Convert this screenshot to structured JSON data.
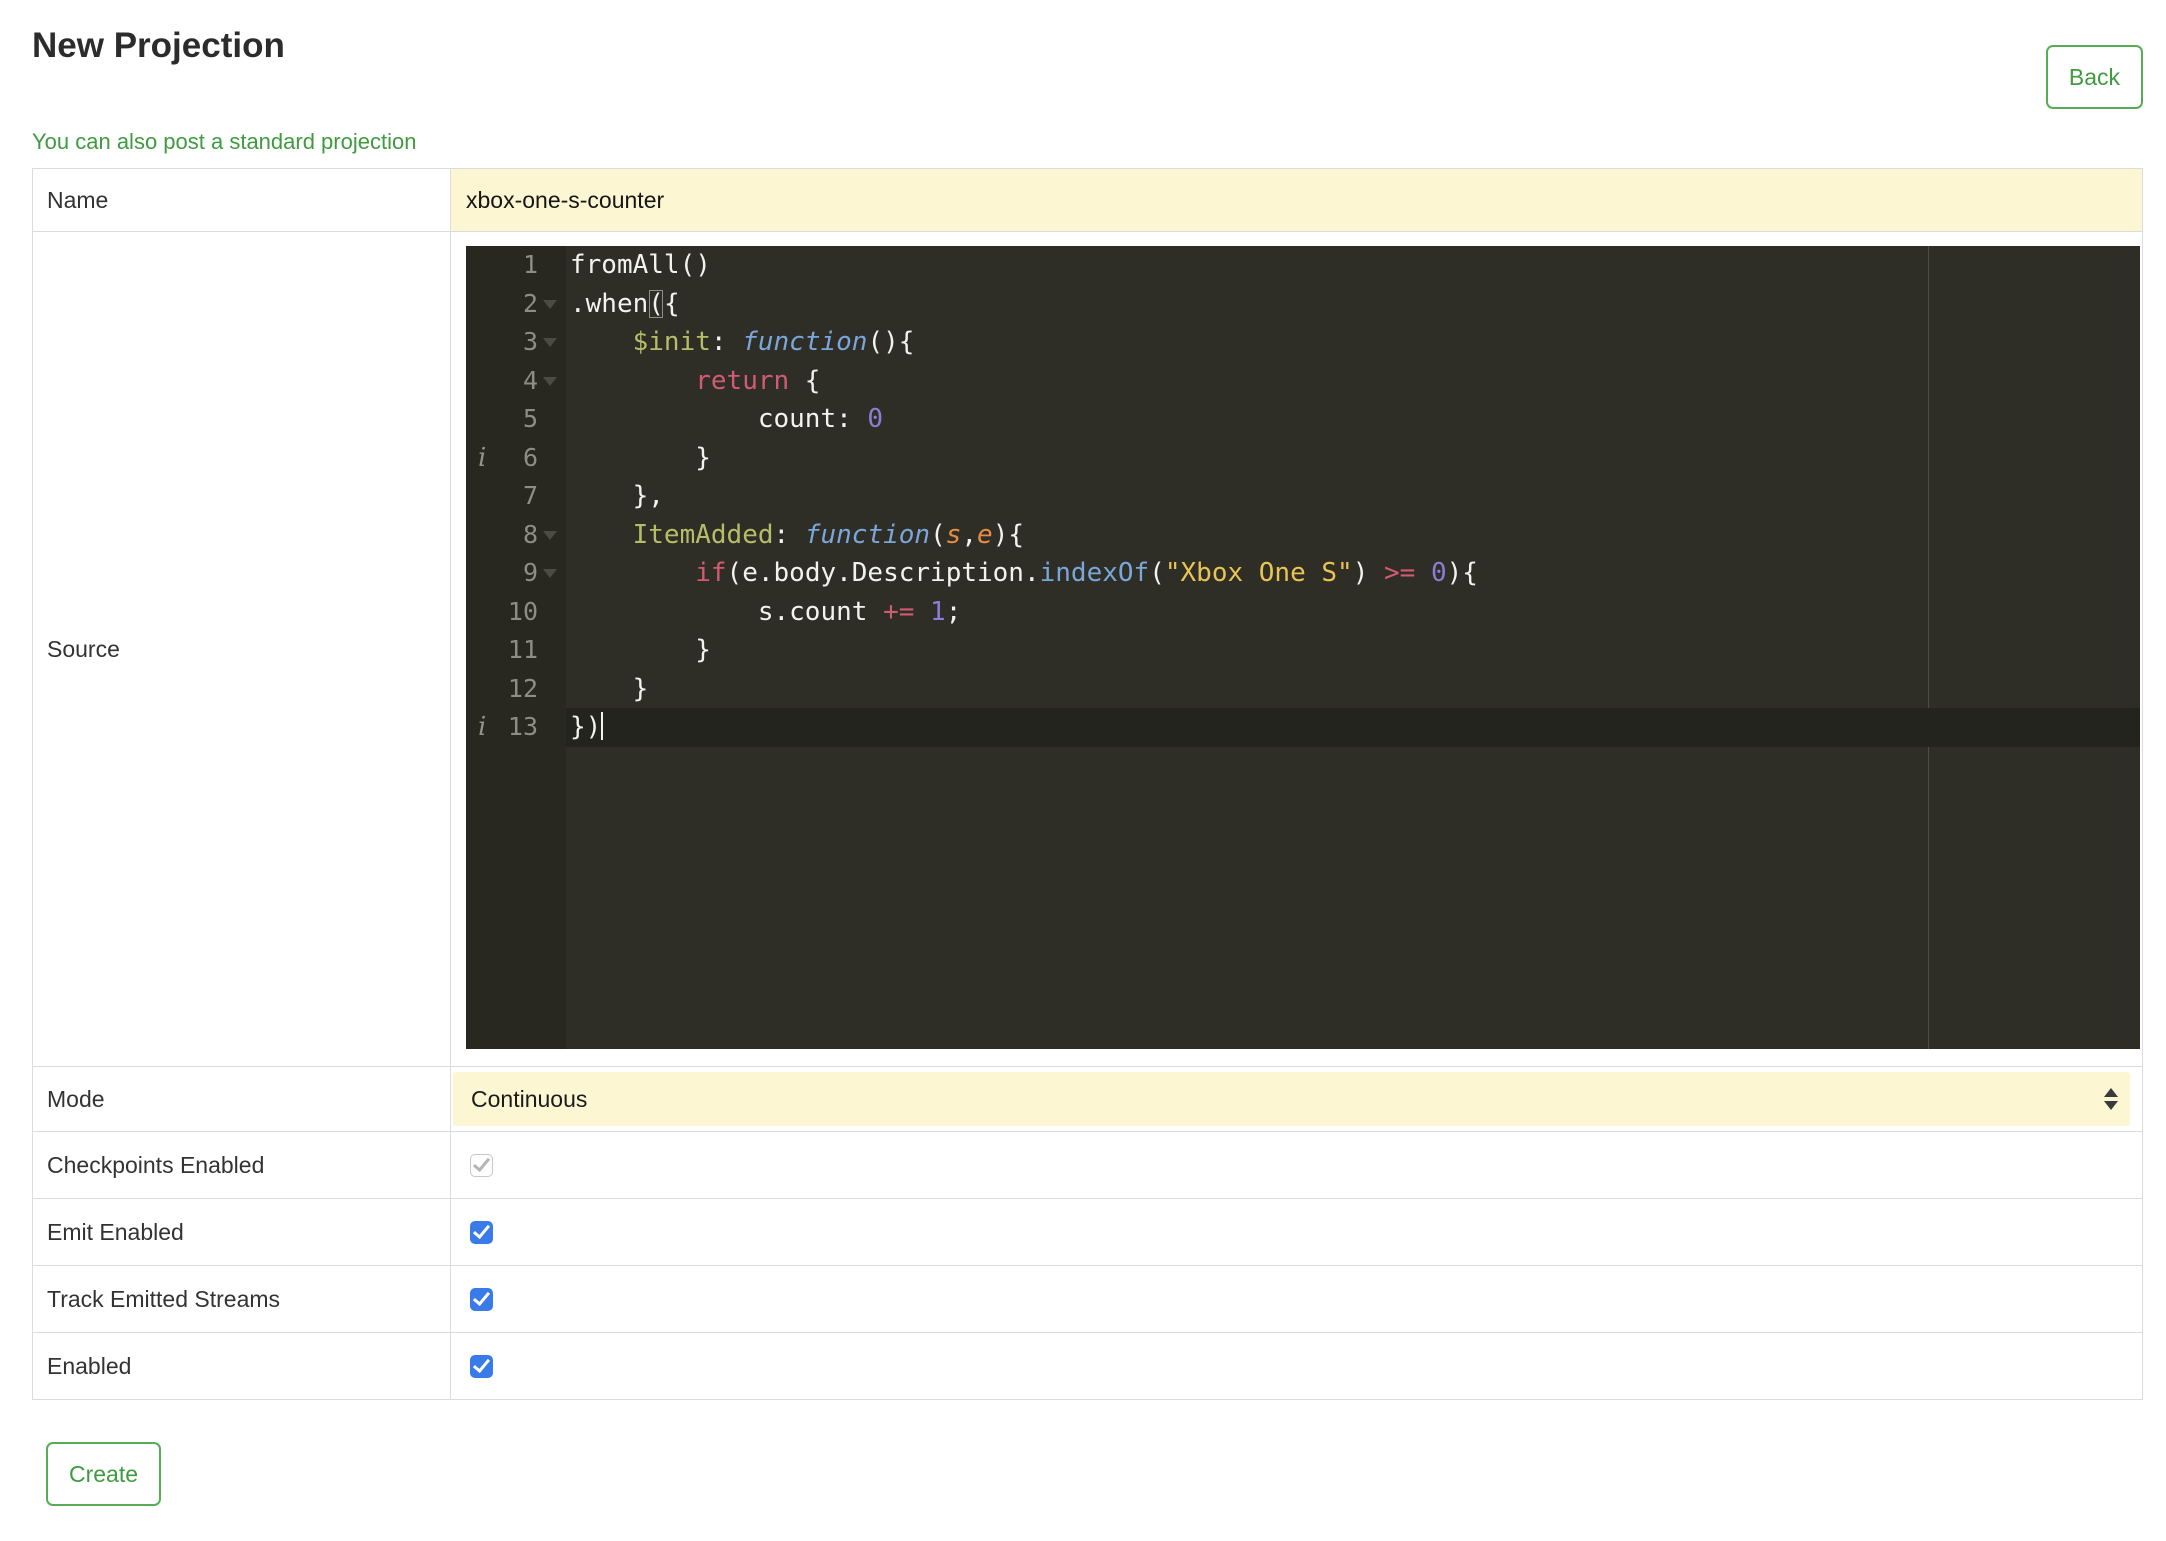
{
  "page": {
    "title": "New Projection",
    "back_label": "Back",
    "standard_projection_link": "You can also post a standard projection",
    "create_label": "Create"
  },
  "form": {
    "name": {
      "label": "Name",
      "value": "xbox-one-s-counter"
    },
    "source": {
      "label": "Source"
    },
    "mode": {
      "label": "Mode",
      "value": "Continuous"
    },
    "checkpoints": {
      "label": "Checkpoints Enabled",
      "checked": true,
      "disabled": true
    },
    "emit": {
      "label": "Emit Enabled",
      "checked": true,
      "disabled": false
    },
    "track": {
      "label": "Track Emitted Streams",
      "checked": true,
      "disabled": false
    },
    "enabled": {
      "label": "Enabled",
      "checked": true,
      "disabled": false
    }
  },
  "editor": {
    "lines": [
      {
        "num": 1,
        "tokens": [
          [
            "fromAll()",
            ""
          ]
        ]
      },
      {
        "num": 2,
        "fold": true,
        "tokens": [
          [
            ".when",
            ""
          ],
          [
            "(",
            "bracket"
          ],
          [
            "{",
            ""
          ]
        ]
      },
      {
        "num": 3,
        "fold": true,
        "tokens": [
          [
            "    ",
            ""
          ],
          [
            "$init",
            "key"
          ],
          [
            ": ",
            ""
          ],
          [
            "function",
            "fn"
          ],
          [
            "(){",
            ""
          ]
        ]
      },
      {
        "num": 4,
        "fold": true,
        "tokens": [
          [
            "        ",
            ""
          ],
          [
            "return",
            "kw"
          ],
          [
            " {",
            ""
          ]
        ]
      },
      {
        "num": 5,
        "tokens": [
          [
            "            count: ",
            ""
          ],
          [
            "0",
            "num"
          ]
        ]
      },
      {
        "num": 6,
        "info": true,
        "tokens": [
          [
            "        }",
            ""
          ]
        ]
      },
      {
        "num": 7,
        "tokens": [
          [
            "    },",
            ""
          ]
        ]
      },
      {
        "num": 8,
        "fold": true,
        "tokens": [
          [
            "    ",
            ""
          ],
          [
            "ItemAdded",
            "key"
          ],
          [
            ": ",
            ""
          ],
          [
            "function",
            "fn"
          ],
          [
            "(",
            ""
          ],
          [
            "s",
            "arg"
          ],
          [
            ",",
            ""
          ],
          [
            "e",
            "arg"
          ],
          [
            "){",
            ""
          ]
        ]
      },
      {
        "num": 9,
        "fold": true,
        "tokens": [
          [
            "        ",
            ""
          ],
          [
            "if",
            "kw"
          ],
          [
            "(e.body.Description.",
            ""
          ],
          [
            "indexOf",
            "mth"
          ],
          [
            "(",
            ""
          ],
          [
            "\"Xbox One S\"",
            "str"
          ],
          [
            ") ",
            ""
          ],
          [
            ">=",
            "kw"
          ],
          [
            " ",
            ""
          ],
          [
            "0",
            "num"
          ],
          [
            "){",
            ""
          ]
        ]
      },
      {
        "num": 10,
        "tokens": [
          [
            "            s.count ",
            ""
          ],
          [
            "+=",
            "kw"
          ],
          [
            " ",
            ""
          ],
          [
            "1",
            "num"
          ],
          [
            ";",
            ""
          ]
        ]
      },
      {
        "num": 11,
        "tokens": [
          [
            "        }",
            ""
          ]
        ]
      },
      {
        "num": 12,
        "tokens": [
          [
            "    }",
            ""
          ]
        ]
      },
      {
        "num": 13,
        "info": true,
        "active": true,
        "cursor": true,
        "tokens": [
          [
            "})",
            ""
          ]
        ]
      }
    ]
  },
  "colors": {
    "accent_green": "#3f9b3f",
    "button_border_green": "#57ad57",
    "input_yellow": "#fcf6d2",
    "checkbox_blue": "#3a7bea",
    "editor_bg": "#2e2e27",
    "editor_gutter_bg": "#282821",
    "editor_active_line": "#24241e",
    "tok_plain": "#f2f2ee",
    "tok_key": "#b5bd68",
    "tok_fn": "#7aa6da",
    "tok_kw": "#d25b73",
    "tok_num": "#8f7cd6",
    "tok_str": "#e8c454",
    "tok_arg": "#e78c45",
    "tok_mth": "#7aa6da",
    "line_number": "#8d8d84"
  }
}
